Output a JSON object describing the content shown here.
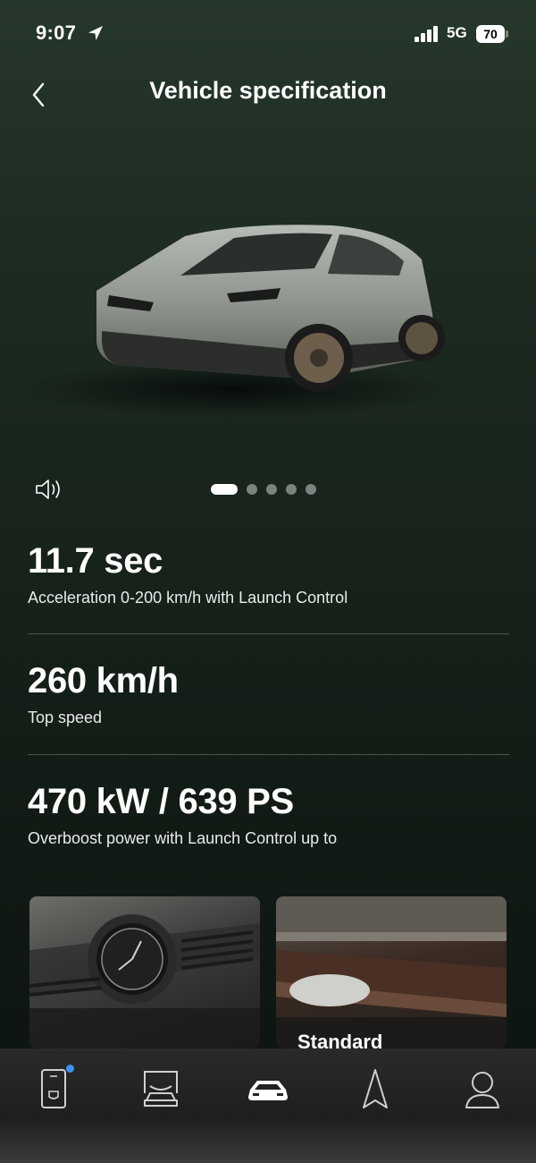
{
  "status_bar": {
    "time": "9:07",
    "network": "5G",
    "battery": "70",
    "icons": [
      "location-arrow-icon",
      "signal-bars-icon"
    ]
  },
  "header": {
    "title": "Vehicle specification",
    "back_icon": "chevron-left-icon"
  },
  "gallery": {
    "sound_icon": "speaker-icon",
    "page_count": 5,
    "active_page": 1
  },
  "specs": [
    {
      "value": "11.7 sec",
      "label": "Acceleration 0-200 km/h with Launch Control"
    },
    {
      "value": "260 km/h",
      "label": "Top speed"
    },
    {
      "value": "470 kW / 639 PS",
      "label": "Overboost power with Launch Control up to"
    }
  ],
  "cards": [
    {
      "caption": ""
    },
    {
      "caption": "Standard"
    }
  ],
  "tab_bar": {
    "tabs": [
      "key-card-icon",
      "vehicle-lift-icon",
      "car-icon",
      "navigation-icon",
      "profile-icon"
    ],
    "active_tab": "car-icon",
    "badge_color": "#3f8ff3"
  },
  "colors": {
    "background": "#1c2a20",
    "accent_dot": "#3f8ff3"
  }
}
